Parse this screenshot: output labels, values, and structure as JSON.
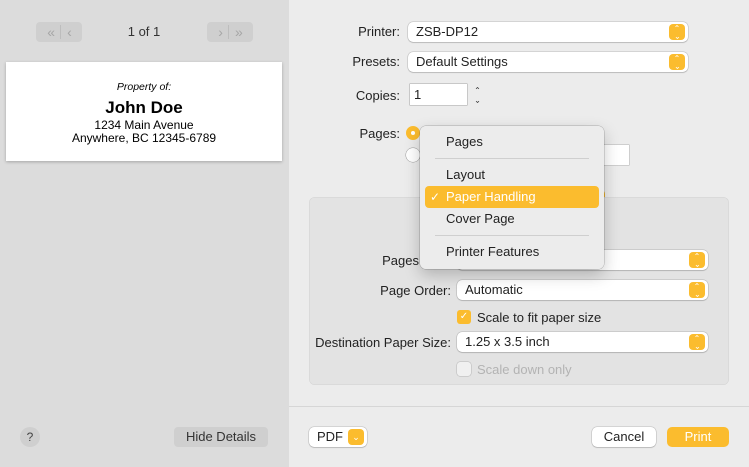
{
  "sidebar": {
    "page_counter": "1 of 1",
    "first_prev_icon": "«  ‹",
    "next_last_icon": "›  »",
    "preview": {
      "line1": "Property of:",
      "line2": "John Doe",
      "line3": "1234 Main Avenue",
      "line4": "Anywhere, BC 12345-6789"
    },
    "help_label": "?",
    "hide_details_label": "Hide Details"
  },
  "main": {
    "printer_label": "Printer:",
    "printer_value": "ZSB-DP12",
    "presets_label": "Presets:",
    "presets_value": "Default Settings",
    "copies_label": "Copies:",
    "copies_value": "1",
    "pages_label": "Pages:",
    "panel": {
      "pages_label": "Pages",
      "page_order_label": "Page Order:",
      "page_order_value": "Automatic",
      "scale_to_fit_label": "Scale to fit paper size",
      "scale_to_fit_checked": true,
      "dest_paper_label": "Destination Paper Size:",
      "dest_paper_value": "1.25 x 3.5 inch",
      "scale_down_label": "Scale down only",
      "scale_down_checked": false
    },
    "pdf_label": "PDF",
    "cancel_label": "Cancel",
    "print_label": "Print"
  },
  "menu": {
    "items": [
      {
        "label": "Pages"
      },
      {
        "label": "Layout"
      },
      {
        "label": "Paper Handling",
        "selected": true
      },
      {
        "label": "Cover Page"
      },
      {
        "label": "Printer Features"
      }
    ],
    "check_glyph": "✓"
  },
  "colors": {
    "accent": "#fbbc2e",
    "sidebar_bg": "#dcdcdc",
    "main_bg": "#ececec"
  }
}
